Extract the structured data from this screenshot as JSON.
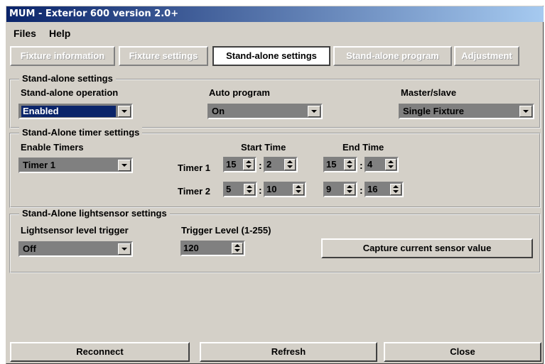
{
  "window": {
    "title": "MUM - Exterior 600 version 2.0+"
  },
  "menu": {
    "files": "Files",
    "help": "Help"
  },
  "tabs": [
    {
      "label": "Fixture information"
    },
    {
      "label": "Fixture settings"
    },
    {
      "label": "Stand-alone settings"
    },
    {
      "label": "Stand-alone program"
    },
    {
      "label": "Adjustment"
    }
  ],
  "standalone": {
    "group_title": "Stand-alone settings",
    "operation_label": "Stand-alone operation",
    "operation_value": "Enabled",
    "auto_label": "Auto program",
    "auto_value": "On",
    "master_label": "Master/slave",
    "master_value": "Single Fixture"
  },
  "timers": {
    "group_title": "Stand-Alone timer settings",
    "enable_label": "Enable Timers",
    "enable_value": "Timer 1",
    "start_label": "Start Time",
    "end_label": "End Time",
    "rows": [
      {
        "label": "Timer 1",
        "start_h": "15",
        "start_m": "2",
        "end_h": "15",
        "end_m": "4"
      },
      {
        "label": "Timer 2",
        "start_h": "5",
        "start_m": "10",
        "end_h": "9",
        "end_m": "16"
      }
    ],
    "colon": ":"
  },
  "lightsensor": {
    "group_title": "Stand-Alone lightsensor settings",
    "trigger_label": "Lightsensor level trigger",
    "trigger_value": "Off",
    "level_label": "Trigger Level (1-255)",
    "level_value": "120",
    "capture_button": "Capture current sensor value"
  },
  "footer": {
    "reconnect": "Reconnect",
    "refresh": "Refresh",
    "close": "Close"
  }
}
